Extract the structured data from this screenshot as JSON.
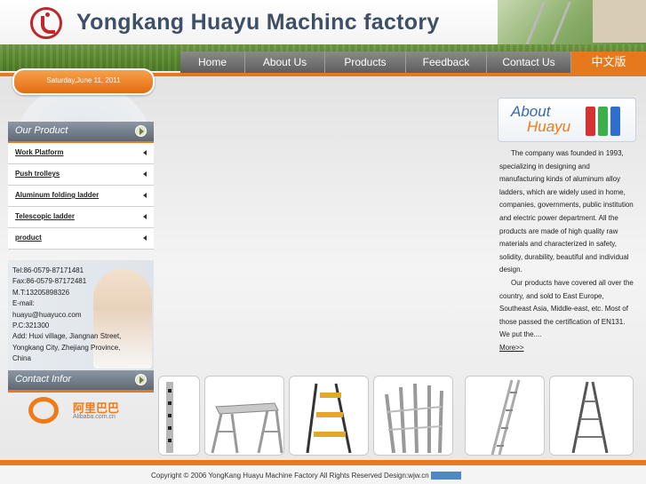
{
  "header": {
    "title": "Yongkang Huayu Machinc factory"
  },
  "nav": {
    "items": [
      {
        "label": "Home"
      },
      {
        "label": "About Us"
      },
      {
        "label": "Products"
      },
      {
        "label": "Feedback"
      },
      {
        "label": "Contact Us"
      },
      {
        "label": "中文版"
      }
    ]
  },
  "date": "Saturday,June 11, 2011",
  "sidebar": {
    "product_title": "Our Product",
    "products": [
      {
        "label": "Work Platform"
      },
      {
        "label": "Push trolleys"
      },
      {
        "label": "Aluminum folding ladder"
      },
      {
        "label": "Telescopic ladder"
      },
      {
        "label": "product"
      }
    ],
    "contact_lines": [
      "Tel:86-0579-87171481",
      "Fax:86-0579-87172481",
      "M.T:13205898326",
      "E-mail:",
      "huayu@huayuco.com",
      "P.C:321300",
      "Add: Huxi village, Jiangnan Street,",
      "Yongkang City, Zhejiang Province,",
      "China"
    ],
    "contact_title": "Contact Infor",
    "alibaba_cn": "阿里巴巴",
    "alibaba_en": "Alibaba.com.cn"
  },
  "about": {
    "title_line1": "About",
    "title_line2": "Huayu",
    "paragraph1": "The company was founded in 1993, specializing in designing and manufacturing kinds of aluminum alloy ladders, which are widely used in home, companies, governments, public institution and electric power department. All the products are made of high quality raw materials and characterized in safety, solidity, durability, beautiful and individual design.",
    "paragraph2": "Our products have covered all over the country, and sold to East Europe, Southeast Asia, Middle-east, etc. Most of those passed the certification of EN131. We put the....",
    "more": "More>>"
  },
  "footer": {
    "text": "Copyright © 2006 YongKang Huayu Machine Factory All Rights Reserved Design:wjw.cn"
  },
  "colors": {
    "accent_orange": "#e6791c",
    "nav_gray": "#6e6e6e",
    "title_blue": "#3e5067"
  }
}
